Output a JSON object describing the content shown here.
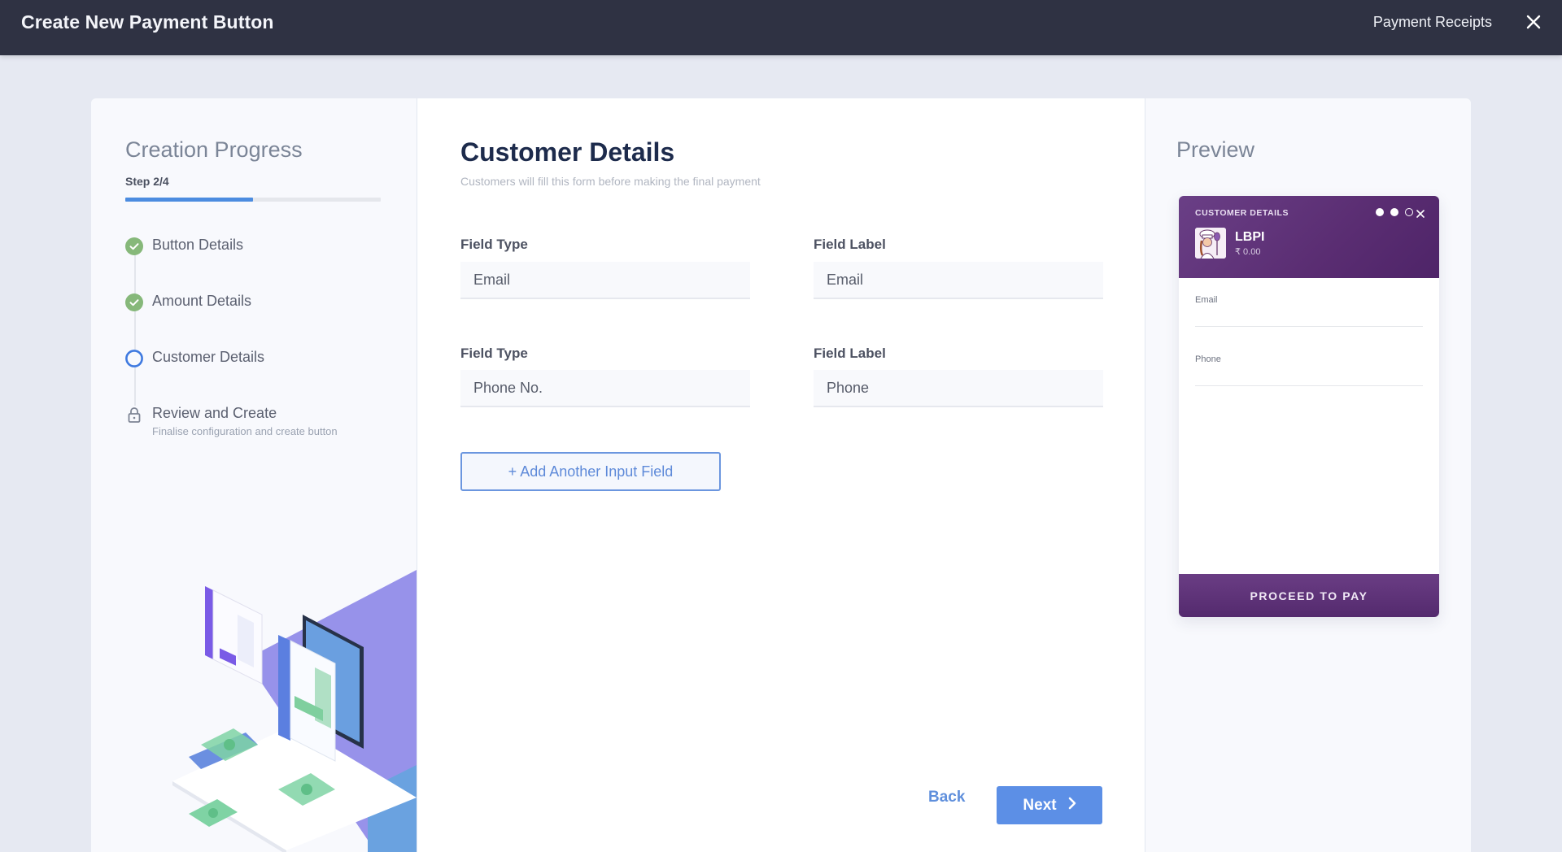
{
  "header": {
    "title": "Create New Payment Button",
    "receipts_link": "Payment Receipts",
    "close_icon": "close-icon"
  },
  "progress": {
    "title": "Creation Progress",
    "step_text": "Step 2/4",
    "fraction": 0.5,
    "accent_color": "#4c8ce0",
    "steps": [
      {
        "label": "Button Details",
        "status": "complete",
        "icon": "check-circle-icon"
      },
      {
        "label": "Amount Details",
        "status": "complete",
        "icon": "check-circle-icon"
      },
      {
        "label": "Customer Details",
        "status": "current",
        "icon": "ring-icon"
      },
      {
        "label": "Review and Create",
        "sub": "Finalise configuration and create button",
        "status": "locked",
        "icon": "lock-icon"
      }
    ]
  },
  "main": {
    "title": "Customer Details",
    "subtitle": "Customers will fill this form before making the final payment",
    "rows": [
      {
        "type_label": "Field Type",
        "type_value": "Email",
        "label_label": "Field Label",
        "label_value": "Email"
      },
      {
        "type_label": "Field Type",
        "type_value": "Phone No.",
        "label_label": "Field Label",
        "label_value": "Phone"
      }
    ],
    "add_button": "+ Add Another Input Field",
    "back_button": "Back",
    "next_button": "Next"
  },
  "preview": {
    "title": "Preview",
    "card": {
      "header_title": "CUSTOMER DETAILS",
      "step_dots": [
        true,
        true,
        false
      ],
      "merchant_name": "LBPI",
      "amount": "₹ 0.00",
      "fields": [
        "Email",
        "Phone"
      ],
      "cta": "PROCEED TO PAY",
      "theme_color": "#5a2d72"
    }
  }
}
